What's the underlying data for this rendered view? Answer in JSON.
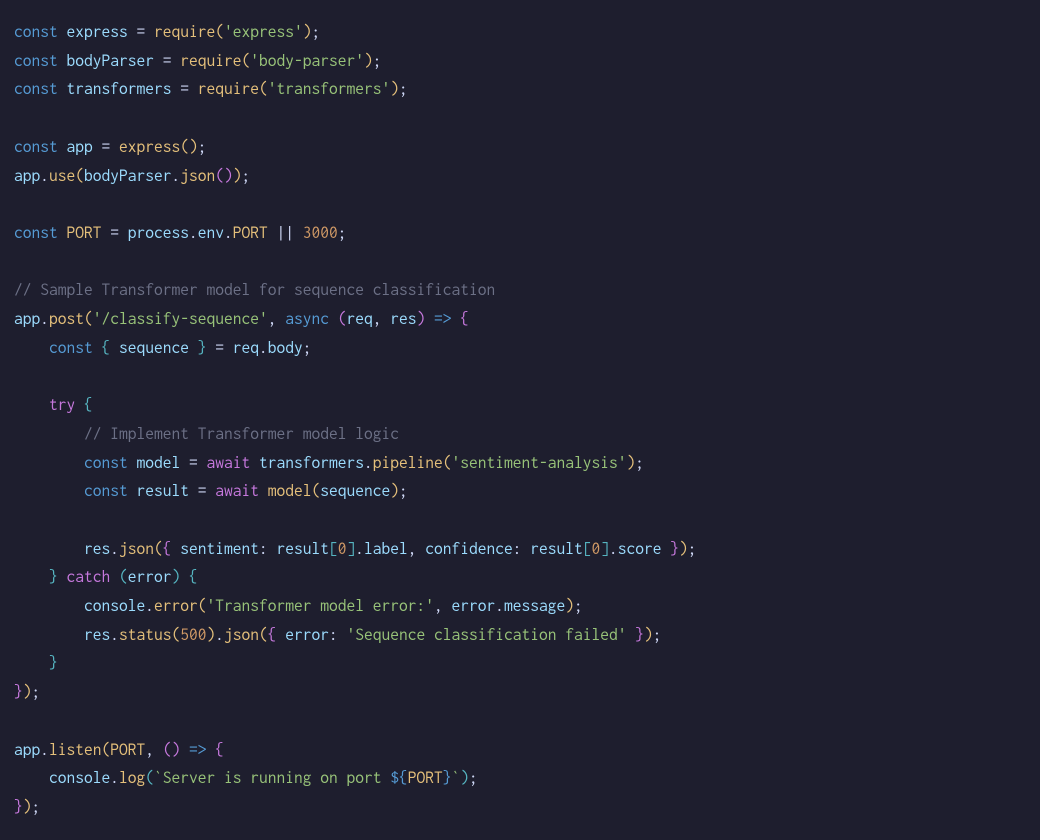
{
  "code": {
    "l1": {
      "kw": "const",
      "id": "express",
      "op": "=",
      "fn": "require",
      "s": "'express'"
    },
    "l2": {
      "kw": "const",
      "id": "bodyParser",
      "op": "=",
      "fn": "require",
      "s": "'body-parser'"
    },
    "l3": {
      "kw": "const",
      "id": "transformers",
      "op": "=",
      "fn": "require",
      "s": "'transformers'"
    },
    "l5": {
      "kw": "const",
      "id": "app",
      "op": "=",
      "fn": "express"
    },
    "l6": {
      "obj": "app",
      "m1": "use",
      "arg": "bodyParser",
      "m2": "json"
    },
    "l8": {
      "kw": "const",
      "id": "PORT",
      "op": "=",
      "o1": "process",
      "p1": "env",
      "p2": "PORT",
      "or": "||",
      "n": "3000"
    },
    "l10": {
      "c": "// Sample Transformer model for sequence classification"
    },
    "l11": {
      "obj": "app",
      "m": "post",
      "route": "'/classify-sequence'",
      "as": "async",
      "p1": "req",
      "p2": "res",
      "ar": "=>"
    },
    "l12": {
      "kw": "const",
      "id": "sequence",
      "op": "=",
      "o": "req",
      "p": "body"
    },
    "l14": {
      "kw": "try"
    },
    "l15": {
      "c": "// Implement Transformer model logic"
    },
    "l16": {
      "kw": "const",
      "id": "model",
      "op": "=",
      "aw": "await",
      "o": "transformers",
      "m": "pipeline",
      "s": "'sentiment-analysis'"
    },
    "l17": {
      "kw": "const",
      "id": "result",
      "op": "=",
      "aw": "await",
      "fn": "model",
      "arg": "sequence"
    },
    "l19": {
      "o": "res",
      "m": "json",
      "k1": "sentiment",
      "r": "result",
      "n0": "0",
      "p1": "label",
      "k2": "confidence",
      "p2": "score"
    },
    "l20": {
      "kw": "catch",
      "e": "error"
    },
    "l21": {
      "o": "console",
      "m": "error",
      "s": "'Transformer model error:'",
      "e": "error",
      "p": "message"
    },
    "l22": {
      "o": "res",
      "m1": "status",
      "n": "500",
      "m2": "json",
      "k": "error",
      "s": "'Sequence classification failed'"
    },
    "l26": {
      "o": "app",
      "m": "listen",
      "a": "PORT",
      "ar": "=>"
    },
    "l27": {
      "o": "console",
      "m": "log",
      "s1": "`Server is running on port ",
      "inter": "PORT",
      "s2": "`"
    }
  }
}
